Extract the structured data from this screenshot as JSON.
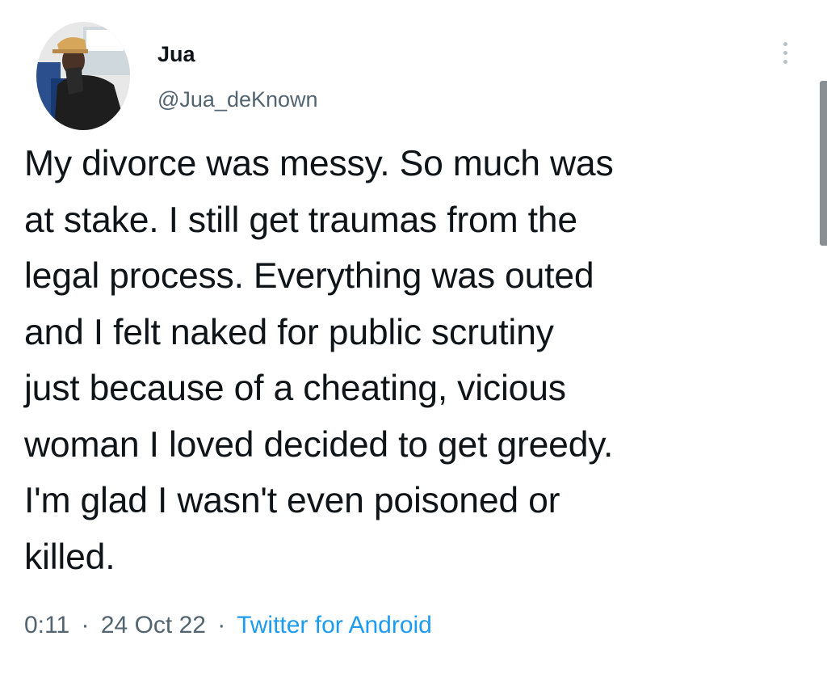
{
  "user": {
    "display_name": "Jua",
    "handle": "@Jua_deKnown"
  },
  "tweet": {
    "text": "My divorce was messy. So much was\nat stake. I still get traumas from the\nlegal process. Everything was outed\nand I felt naked for public scrutiny\njust because of a cheating, vicious\nwoman I loved decided to get greedy.\nI'm glad I wasn't even poisoned or\nkilled.",
    "time": "0:11",
    "date": "24 Oct 22",
    "separator": "·",
    "source": "Twitter for Android"
  },
  "colors": {
    "text": "#0f1419",
    "secondary_text": "#536471",
    "link": "#1d9bf0"
  },
  "icons": {
    "more": "more-vertical-icon"
  }
}
